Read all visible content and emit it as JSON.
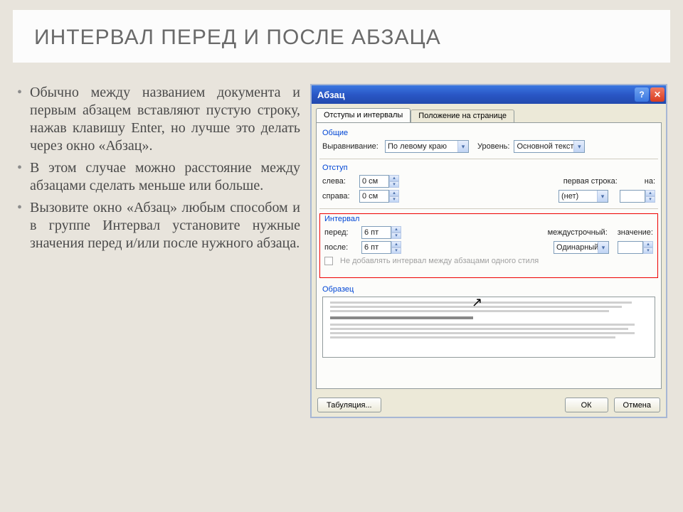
{
  "slide": {
    "title": "ИНТЕРВАЛ ПЕРЕД И ПОСЛЕ АБЗАЦА",
    "bullets": [
      "Обычно между названием документа и первым абзацем вставляют пустую строку, нажав клавишу Enter, но лучше это делать через окно «Абзац».",
      "В этом случае можно расстояние между абзацами сделать меньше или больше.",
      "Вызовите окно «Абзац» любым способом и в группе Интервал установите нужные значения перед и/или после нужного абзаца."
    ]
  },
  "dialog": {
    "title": "Абзац",
    "tabs": {
      "active": "Отступы и интервалы",
      "inactive": "Положение на странице"
    },
    "sections": {
      "general": "Общие",
      "indent": "Отступ",
      "spacing": "Интервал",
      "preview": "Образец"
    },
    "labels": {
      "alignment": "Выравнивание:",
      "level": "Уровень:",
      "left": "слева:",
      "right": "справа:",
      "firstLine": "первая строка:",
      "by": "на:",
      "before": "перед:",
      "after": "после:",
      "lineSpacing": "междустрочный:",
      "value": "значение:",
      "noSpace": "Не добавлять интервал между абзацами одного стиля"
    },
    "values": {
      "alignment": "По левому краю",
      "level": "Основной текст",
      "left": "0 см",
      "right": "0 см",
      "firstLine": "(нет)",
      "by": "",
      "before": "6 пт",
      "after": "6 пт",
      "lineSpacing": "Одинарный",
      "value": ""
    },
    "buttons": {
      "tabs": "Табуляция...",
      "ok": "ОК",
      "cancel": "Отмена"
    }
  }
}
